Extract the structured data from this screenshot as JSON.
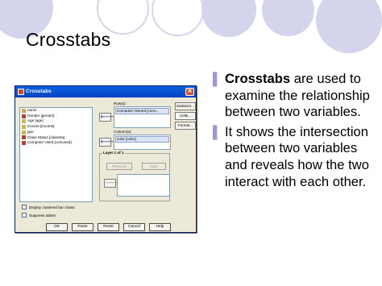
{
  "slide": {
    "title": "Crosstabs",
    "bullets": [
      {
        "bold": "Crosstabs",
        "rest": " are used to examine the relationship between two variables."
      },
      {
        "bold": "",
        "rest": "It shows the intersection between two variables and reveals how the two interact with each other."
      }
    ]
  },
  "dialog": {
    "title": "Crosstabs",
    "variables": [
      "name",
      "Gender [gender]",
      "Age [age]",
      "income [income]",
      "ppe",
      "Class Status [classsta]",
      "Computer Used [comused]"
    ],
    "rows_label": "Row(s):",
    "rows_value": "Computer Owned [cono...",
    "columns_label": "Column(s):",
    "columns_value": "color [color]",
    "layer_label": "Layer 1 of 1",
    "previous_label": "Previous",
    "next_label": "Next",
    "side_buttons": [
      "Statistics...",
      "Cells...",
      "Format..."
    ],
    "checkbox_clustered": "Display clustered bar charts",
    "checkbox_suppress": "Suppress tables",
    "buttons": [
      "OK",
      "Paste",
      "Reset",
      "Cancel",
      "Help"
    ]
  }
}
